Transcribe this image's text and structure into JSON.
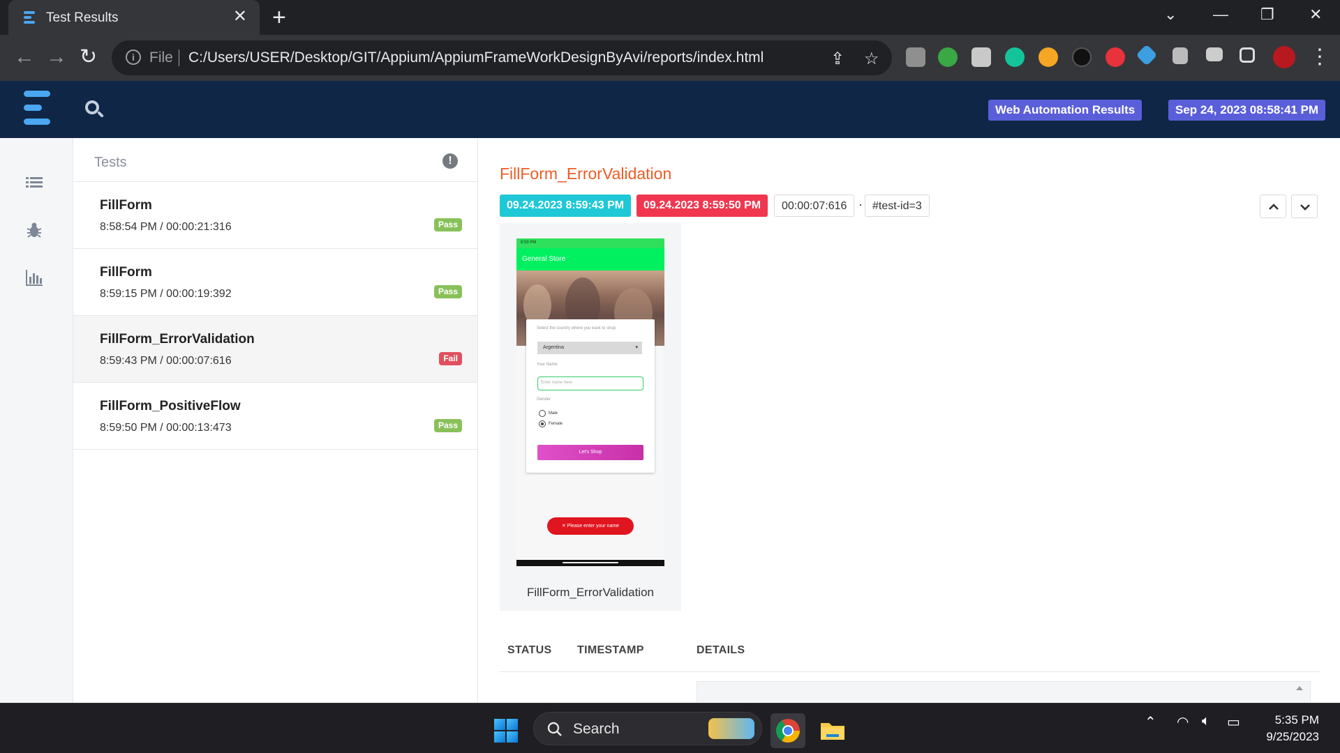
{
  "browser": {
    "tab_title": "Test Results",
    "url_scheme_label": "File",
    "url": "C:/Users/USER/Desktop/GIT/Appium/AppiumFrameWorkDesignByAvi/reports/index.html"
  },
  "header": {
    "report_name": "Web Automation Results",
    "report_date": "Sep 24, 2023 08:58:41 PM"
  },
  "tests_panel": {
    "title": "Tests",
    "items": [
      {
        "name": "FillForm",
        "time": "8:58:54 PM / 00:00:21:316",
        "status": "Pass"
      },
      {
        "name": "FillForm",
        "time": "8:59:15 PM / 00:00:19:392",
        "status": "Pass"
      },
      {
        "name": "FillForm_ErrorValidation",
        "time": "8:59:43 PM / 00:00:07:616",
        "status": "Fail"
      },
      {
        "name": "FillForm_PositiveFlow",
        "time": "8:59:50 PM / 00:00:13:473",
        "status": "Pass"
      }
    ]
  },
  "detail": {
    "title": "FillForm_ErrorValidation",
    "start": "09.24.2023 8:59:43 PM",
    "end": "09.24.2023 8:59:50 PM",
    "duration": "00:00:07:616",
    "separator": "·",
    "test_id": "#test-id=3",
    "screenshot_caption": "FillForm_ErrorValidation",
    "log_columns": [
      "STATUS",
      "TIMESTAMP",
      "DETAILS"
    ]
  },
  "phone_screenshot": {
    "status_time": "8:59 PM",
    "app_bar": "General Store",
    "country_label": "Select the country where you want to shop",
    "country_value": "Argentina",
    "name_label": "Your Name",
    "name_placeholder": "Enter name here",
    "gender_label": "Gender",
    "gender_male": "Male",
    "gender_female": "Female",
    "shop_button": "Let's  Shop",
    "toast": "Please enter your name"
  },
  "taskbar": {
    "search_label": "Search",
    "time": "5:35 PM",
    "date": "9/25/2023"
  },
  "colors": {
    "header_bg": "#0f2646",
    "accent_badge": "#5a5fd9",
    "title_orange": "#ef5b24",
    "start_chip": "#1fc8d6",
    "end_chip": "#f0374f",
    "pass": "#88c15a",
    "fail": "#e0505f"
  }
}
